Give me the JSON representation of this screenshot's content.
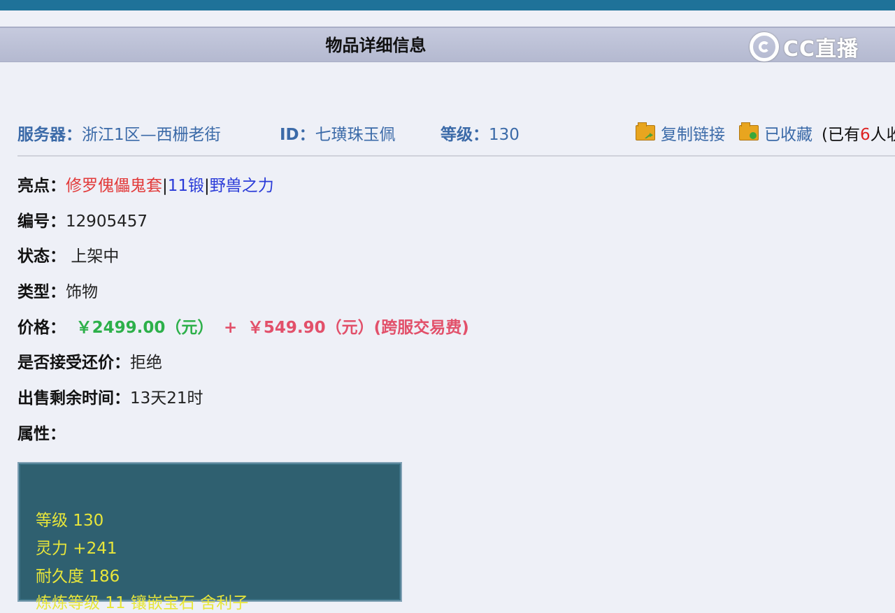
{
  "header": {
    "title": "物品详细信息"
  },
  "watermark": {
    "text": "CC直播"
  },
  "info": {
    "server_label": "服务器：",
    "server_value": "浙江1区—西栅老街",
    "id_label": "ID：",
    "id_value": "七璜珠玉佩",
    "level_label": "等级：",
    "level_value": "130",
    "copy_link": "复制链接",
    "favorited": "已收藏",
    "fav_prefix": "(已有",
    "fav_count": "6",
    "fav_suffix": "人收"
  },
  "details": {
    "highlight_label": "亮点：",
    "highlight_1": "修罗傀儡鬼套",
    "highlight_sep": "|",
    "highlight_2": "11锻",
    "highlight_3": "野兽之力",
    "number_label": "编号：",
    "number_value": "12905457",
    "status_label": "状态：",
    "status_value": "上架中",
    "type_label": "类型：",
    "type_value": "饰物",
    "price_label": "价格：",
    "price_main": "￥2499.00（元）",
    "price_plus": "+",
    "price_fee": "￥549.90（元）(跨服交易费)",
    "bargain_label": "是否接受还价：",
    "bargain_value": "拒绝",
    "remaining_label": "出售剩余时间：",
    "remaining_value": "13天21时",
    "attr_label": "属性："
  },
  "attributes": [
    "等级 130",
    "灵力 +241",
    "耐久度 186",
    "炼炼等级 11  镶嵌宝石 舍利子"
  ],
  "colors": {
    "topbar": "#1f7299",
    "header_bg": "#b4b9d0",
    "info_text": "#3b6aa8",
    "price_green": "#2db04a",
    "price_red": "#e2506a",
    "attr_box": "#2f6070",
    "attr_text": "#e8e63a"
  }
}
